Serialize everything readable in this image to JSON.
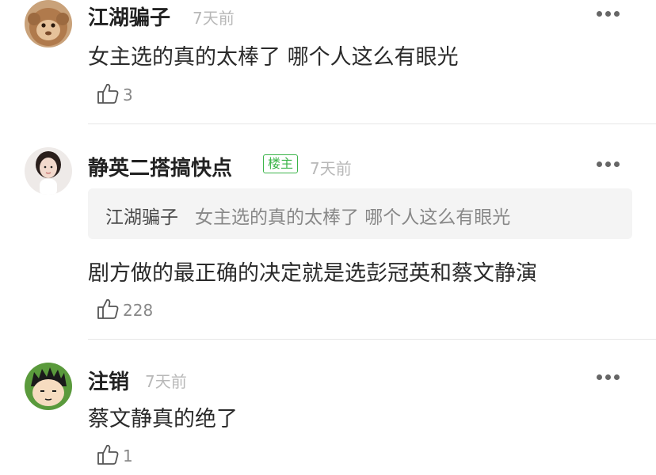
{
  "comments": [
    {
      "username": "江湖骗子",
      "time": "7天前",
      "text": "女主选的真的太棒了  哪个人这么有眼光",
      "likes": "3",
      "avatar_icon": "monkey-avatar"
    },
    {
      "username": "静英二搭搞快点",
      "badge": "楼主",
      "time": "7天前",
      "quote_user": "江湖骗子",
      "quote_text": "女主选的真的太棒了  哪个人这么有眼光",
      "text": "剧方做的最正确的决定就是选彭冠英和蔡文静演",
      "likes": "228",
      "avatar_icon": "girl-avatar"
    },
    {
      "username": "注销",
      "time": "7天前",
      "text": "蔡文静真的绝了",
      "likes": "1",
      "avatar_icon": "cartoon-boy-avatar"
    }
  ],
  "icons": {
    "more": "more-dots-icon",
    "like": "thumbs-up-icon"
  },
  "colors": {
    "badge_green": "#3cb54a",
    "time_gray": "#b8b8b8",
    "quote_bg": "#f4f4f4"
  }
}
